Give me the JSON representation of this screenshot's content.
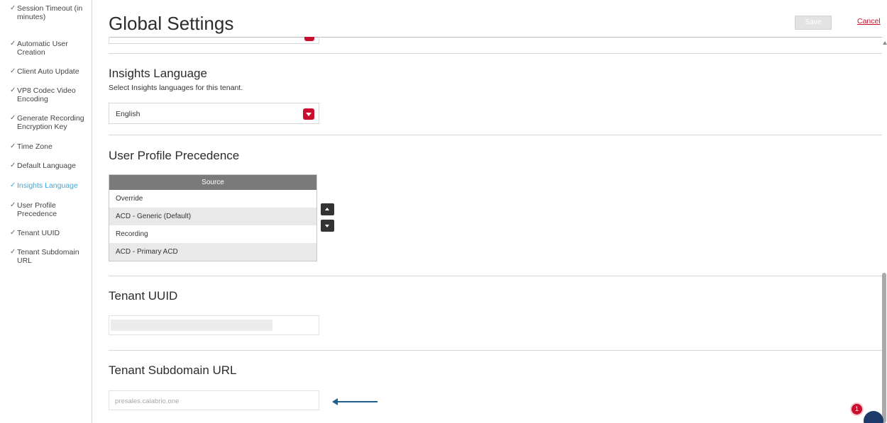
{
  "sidebar": {
    "items": [
      {
        "label": "Session Timeout (in minutes)"
      },
      {
        "label": "Automatic User Creation"
      },
      {
        "label": "Client Auto Update"
      },
      {
        "label": "VP8 Codec Video Encoding"
      },
      {
        "label": "Generate Recording Encryption Key"
      },
      {
        "label": "Time Zone"
      },
      {
        "label": "Default Language"
      },
      {
        "label": "Insights Language"
      },
      {
        "label": "User Profile Precedence"
      },
      {
        "label": "Tenant UUID"
      },
      {
        "label": "Tenant Subdomain URL"
      }
    ],
    "check_glyph": "✓",
    "active_item": "Insights Language"
  },
  "header": {
    "title": "Global Settings",
    "save_label": "Save",
    "cancel_label": "Cancel"
  },
  "insights_language": {
    "title": "Insights Language",
    "description": "Select Insights languages for this tenant.",
    "selected_value": "English"
  },
  "user_profile_precedence": {
    "title": "User Profile Precedence",
    "column_header": "Source",
    "rows": [
      "Override",
      "ACD - Generic (Default)",
      "Recording",
      "ACD - Primary ACD"
    ]
  },
  "tenant_uuid": {
    "title": "Tenant UUID",
    "value": ""
  },
  "tenant_subdomain_url": {
    "title": "Tenant Subdomain URL",
    "placeholder": "presales.calabrio.one"
  },
  "notification": {
    "count": "1"
  },
  "colors": {
    "accent": "#c8102e",
    "active_link": "#3ba9d9",
    "table_header": "#7a7a7a",
    "annotation_arrow": "#1f5f8b"
  }
}
